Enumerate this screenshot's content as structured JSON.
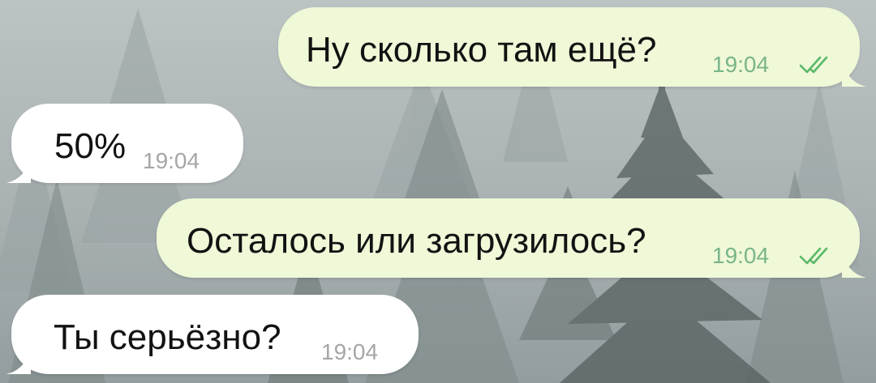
{
  "chat": {
    "messages": [
      {
        "direction": "outgoing",
        "text": "Ну сколько там ещё?",
        "time": "19:04",
        "status_icon": "double-check-icon"
      },
      {
        "direction": "incoming",
        "text": "50%",
        "time": "19:04"
      },
      {
        "direction": "outgoing",
        "text": "Осталось или загрузилось?",
        "time": "19:04",
        "status_icon": "double-check-icon"
      },
      {
        "direction": "incoming",
        "text": "Ты серьёзно?",
        "time": "19:04"
      }
    ]
  },
  "colors": {
    "outgoing_bubble": "#eff8d7",
    "incoming_bubble": "#ffffff",
    "outgoing_time": "#79b58a",
    "incoming_time": "#a6a6a6",
    "read_check": "#59b969"
  }
}
